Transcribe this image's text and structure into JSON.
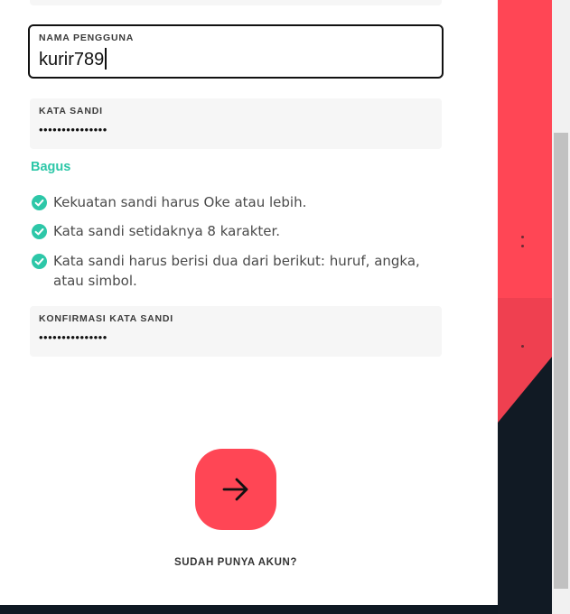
{
  "form": {
    "username_label": "NAMA PENGGUNA",
    "username_value": "kurir789",
    "password_label": "KATA SANDI",
    "password_value": "•••••••••••••••",
    "confirm_label": "KONFIRMASI KATA SANDI",
    "confirm_value": "•••••••••••••••"
  },
  "strength": {
    "label": "Bagus",
    "color": "#2dc7a8"
  },
  "rules": [
    {
      "text": "Kekuatan sandi harus Oke atau lebih.",
      "icon": "check-circle-icon"
    },
    {
      "text": "Kata sandi setidaknya 8 karakter.",
      "icon": "check-circle-icon"
    },
    {
      "text": "Kata sandi harus berisi dua dari berikut: huruf, angka, atau simbol.",
      "icon": "check-circle-icon"
    }
  ],
  "actions": {
    "submit_icon": "arrow-right-icon",
    "have_account": "SUDAH PUNYA AKUN?"
  },
  "colors": {
    "accent": "#ff4655",
    "success": "#2dc7a8",
    "dark": "#0f1923"
  }
}
